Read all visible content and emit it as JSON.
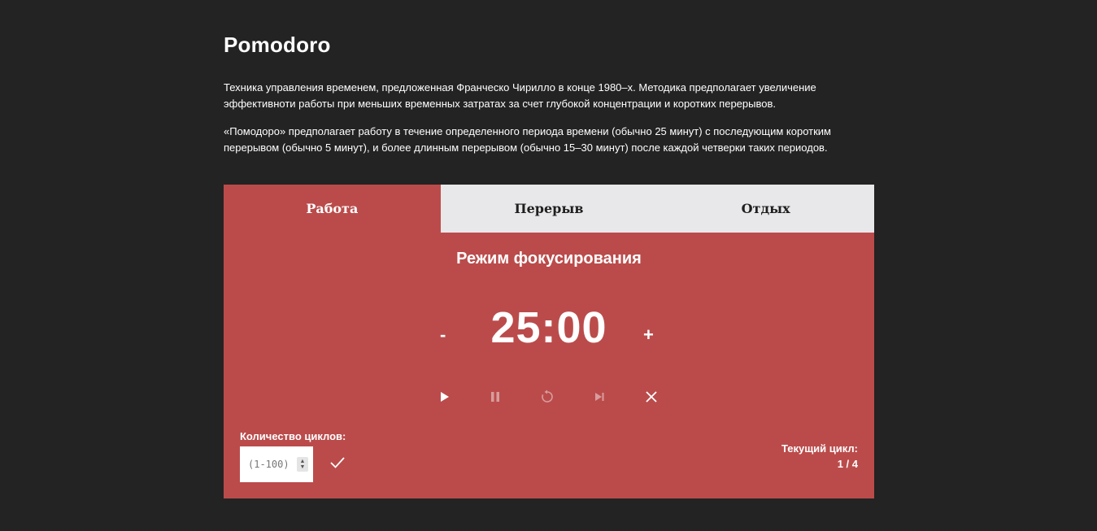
{
  "page": {
    "title": "Pomodoro",
    "description": [
      "Техника управления временем, предложенная Франческо Чирилло в конце 1980–х. Методика предполагает увеличение эффективноти работы при меньших временных затратах за счет глубокой концентрации и коротких перерывов.",
      "«Помодоро» предполагает работу в течение определенного периода времени (обычно 25 минут) с последующим коротким перерывом (обычно 5 минут), и более длинным перерывом (обычно 15–30 минут) после каждой четверки таких периодов."
    ]
  },
  "tabs": [
    {
      "label": "Работа",
      "active": true
    },
    {
      "label": "Перерыв",
      "active": false
    },
    {
      "label": "Отдых",
      "active": false
    }
  ],
  "timer": {
    "mode": "Режим фокусирования",
    "time": "25:00",
    "decrease_label": "-",
    "increase_label": "+"
  },
  "controls": [
    {
      "name": "play-icon",
      "enabled": true
    },
    {
      "name": "pause-icon",
      "enabled": false
    },
    {
      "name": "restart-icon",
      "enabled": false
    },
    {
      "name": "skip-next-icon",
      "enabled": false
    },
    {
      "name": "close-icon",
      "enabled": true
    }
  ],
  "cycles": {
    "label": "Количество циклов:",
    "placeholder": "(1-100)",
    "value": ""
  },
  "current_cycle": {
    "label": "Текущий цикл:",
    "value": "1 / 4"
  },
  "colors": {
    "background": "#232323",
    "panel": "#bb4b4b",
    "tab_inactive": "#e8e8ea"
  }
}
